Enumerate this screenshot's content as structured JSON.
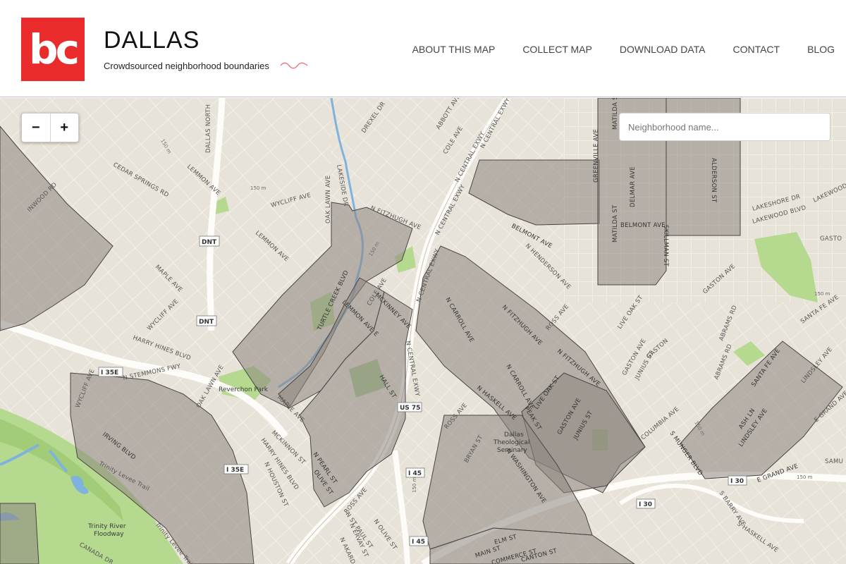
{
  "header": {
    "logo_text": "bc",
    "title": "DALLAS",
    "tagline": "Crowdsourced neighborhood boundaries",
    "brand_color": "#ea2b2b"
  },
  "nav": [
    {
      "label": "ABOUT THIS MAP"
    },
    {
      "label": "COLLECT MAP"
    },
    {
      "label": "DOWNLOAD DATA"
    },
    {
      "label": "CONTACT"
    },
    {
      "label": "BLOG"
    }
  ],
  "map": {
    "zoom_out_label": "−",
    "zoom_in_label": "+",
    "search_placeholder": "Neighborhood name...",
    "base_color": "#e8e3d8",
    "overlay_color": "#8c8580",
    "park_color": "#b5d98f",
    "water_color": "#a9cbe6",
    "icons": [
      "zoom-out-icon",
      "zoom-in-icon"
    ],
    "shields": {
      "dnt1": "DNT",
      "dnt2": "DNT",
      "i35e_1": "I 35E",
      "i35e_2": "I 35E",
      "us75": "US 75",
      "i45_1": "I 45",
      "i45_2": "I 45",
      "i30_1": "I 30",
      "i30_2": "I 30"
    },
    "places": {
      "reverchon": "Reverchon Park",
      "seminary_1": "Dallas",
      "seminary_2": "Theological",
      "seminary_3": "Seminary",
      "floodway_1": "Trinity River",
      "floodway_2": "Floodway",
      "levee_1": "Trinity Levee Trail",
      "levee_2": "Trinity Levee Trail"
    },
    "streets": {
      "dallas_n": "DALLAS NORTH",
      "lemmon1": "LEMMON AVE",
      "lemmon2": "LEMMON AVE",
      "cedar_springs": "CEDAR SPRINGS RD",
      "inwood": "INWOOD RD",
      "wycliff1": "WYCLIFF AVE",
      "wycliff2": "WYCLIFF AVE",
      "wycliff3": "WYCLIFF AVE",
      "maple1": "MAPLE AVE",
      "maple2": "MAPLE AVE",
      "oak_lawn1": "OAK LAWN AVE",
      "oak_lawn2": "OAK LAWN AVE",
      "lakeside": "LAKESIDE DR",
      "drexel": "DREXEL DR",
      "abbott": "ABBOTT AVE",
      "cole1": "COLE AVE",
      "cole2": "COLE AVE",
      "n_central_1": "N CENTRAL EXWY",
      "n_central_2": "N CENTRAL EXWY",
      "n_central_3": "N CENTRAL EXWY",
      "n_central_4": "N CENTRAL EXWY",
      "n_central_5": "N CENTRAL EXWY",
      "fitzhugh": "N FITZHUGH AVE",
      "fitzhugh2": "N FITZHUGH AVE",
      "fitzhugh3": "N FITZHUGH AVE",
      "turtle_creek": "TURTLE CREEK BLVD",
      "lemmon_e": "LEMMON AVE E",
      "mckinney1": "MCKINNEY AVE",
      "mckinney2": "MCKINNEY AVE",
      "harry_hines1": "HARRY HINES BLVD",
      "harry_hines2": "HARRY HINES BLVD",
      "stemmons": "N STEMMONS FWY",
      "irving": "IRVING BLVD",
      "mckinnon": "MCKINNON ST",
      "n_pearl": "N PEARL ST",
      "olive": "OLIVE ST",
      "n_olive": "N OLIVE ST",
      "n_houston": "N HOUSTON ST",
      "ross1": "ROSS AVE",
      "ross2": "ROSS AVE",
      "ross3": "ROSS AVE",
      "hall": "HALL ST",
      "n_carroll1": "N CARROLL AVE",
      "n_carroll2": "N CARROLL AVE",
      "n_haskell": "N HASKELL AVE",
      "peak": "PEAK ST",
      "live_oak1": "LIVE OAK ST",
      "live_oak2": "LIVE OAK ST",
      "gaston1": "GASTON AVE",
      "gaston2": "GASTON AVE",
      "gaston3": "GASTON AVE",
      "gaston4": "GASTON AVE",
      "gaston5": "GASTON",
      "junius1": "JUNIUS ST",
      "junius2": "JUNIUS ST",
      "bryan": "BRYAN ST",
      "n_washington": "N WASHINGTON AVE",
      "main1": "MAIN ST",
      "main2": "MAIN ST",
      "elm": "ELM ST",
      "commerce": "COMMERCE ST",
      "canton": "CANTON ST",
      "belmont1": "BELMONT AVE",
      "belmont2": "BELMONT AVE",
      "n_henderson": "N HENDERSON AVE",
      "greenville": "GREENVILLE AVE",
      "matilda1": "MATILDA ST",
      "matilda2": "MATILDA ST",
      "delmar": "DELMAR AVE",
      "skillman": "SKILLMAN ST",
      "alderson": "ALDERSON ST",
      "lakeshore": "LAKESHORE DR",
      "lakewood1": "LAKEWOOD BLVD",
      "lakewood2": "LAKEWOOD",
      "abrams1": "ABRAMS RD",
      "abrams2": "ABRAMS RD",
      "santa_fe1": "SANTA FE AVE",
      "santa_fe2": "SANTA FE AVE",
      "lindsley1": "LINDSLEY AVE",
      "lindsley2": "LINDSLEY AVE",
      "ash": "ASH LN",
      "e_grand1": "E GRAND AVE",
      "e_grand2": "E GRAND AVE",
      "columbia": "COLUMBIA AVE",
      "s_munger": "S MUNGER BLVD",
      "s_barry": "S BARRY AVE",
      "s_haskell": "S HASKELL AVE",
      "canada": "CANADA DR",
      "n_akard": "N AKARD ST",
      "n_ervay": "N ERVAY ST",
      "n_st_paul": "N ST PAUL ST",
      "gasto": "GASTO",
      "samu": "SAMU",
      "dnt_main": "DALLAS N"
    },
    "scale_labels": [
      "150 m",
      "150 m",
      "150 m",
      "150 m",
      "150 m",
      "150 m",
      "150 m"
    ]
  }
}
